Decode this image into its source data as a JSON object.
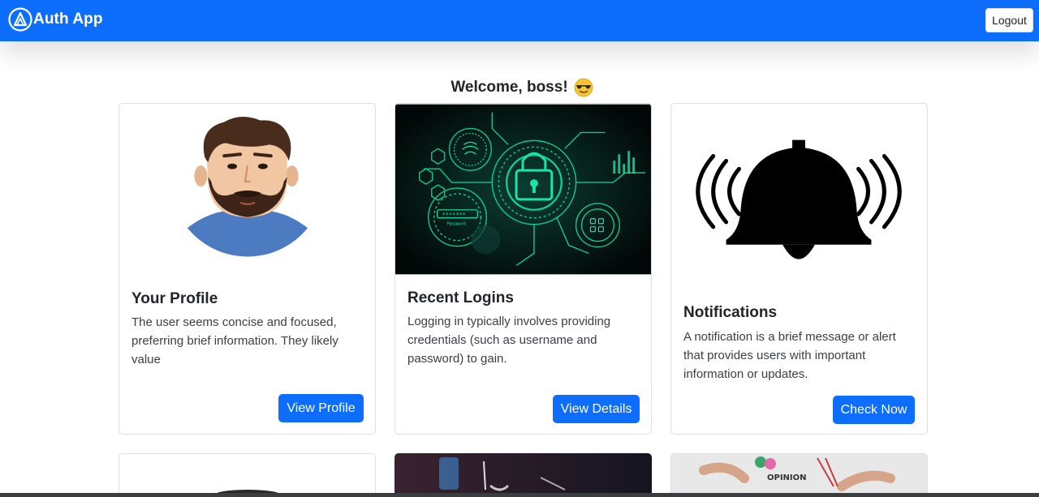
{
  "navbar": {
    "brand": "Auth App",
    "logout_label": "Logout"
  },
  "welcome": "Welcome, boss!",
  "cards": [
    {
      "title": "Your Profile",
      "text": "The user seems concise and focused, preferring brief information. They likely value",
      "button": "View Profile"
    },
    {
      "title": "Recent Logins",
      "text": "Logging in typically involves providing credentials (such as username and password) to gain.",
      "button": "View Details",
      "image_label": "Password"
    },
    {
      "title": "Notifications",
      "text": "A notification is a brief message or alert that provides users with important information or updates.",
      "button": "Check Now"
    }
  ],
  "bottom_cards": [
    {
      "image_label": "OPINION"
    }
  ],
  "colors": {
    "primary": "#0d6efd",
    "text": "#212529",
    "security_green": "#19e3a5"
  }
}
